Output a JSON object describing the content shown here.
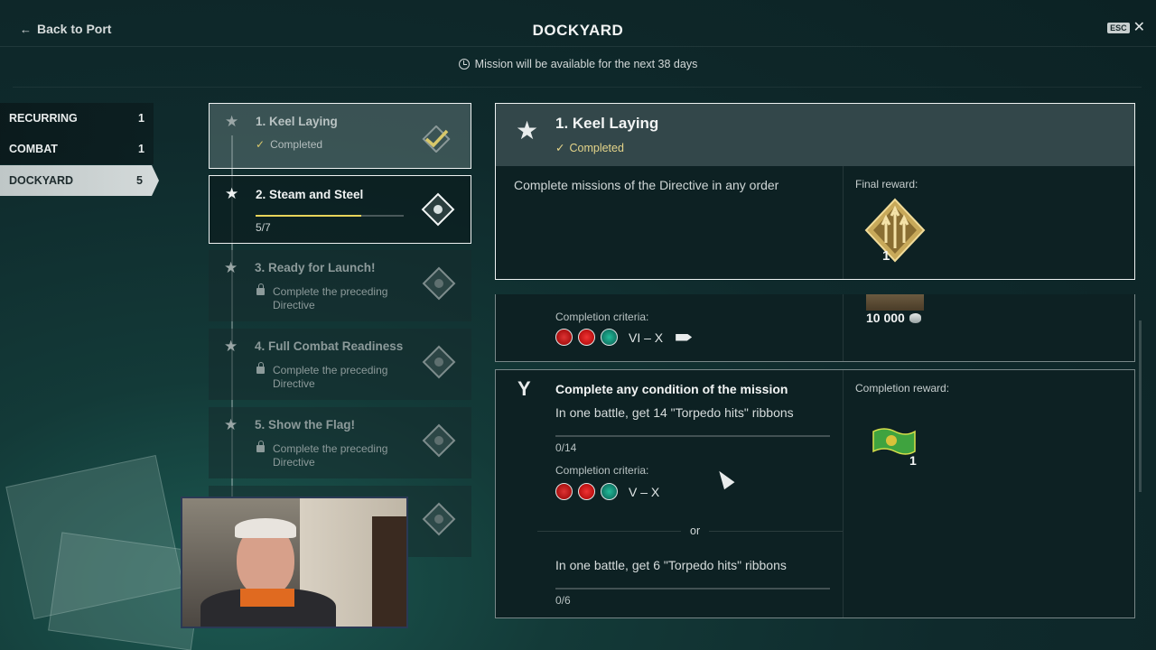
{
  "header": {
    "back_label": "Back to Port",
    "title": "DOCKYARD",
    "esc_label": "ESC",
    "availability": "Mission will be available for the next 38 days"
  },
  "categories": [
    {
      "label": "RECURRING",
      "count": "1"
    },
    {
      "label": "COMBAT",
      "count": "1"
    },
    {
      "label": "DOCKYARD",
      "count": "5"
    }
  ],
  "missions": [
    {
      "name": "1. Keel Laying",
      "status": "Completed"
    },
    {
      "name": "2. Steam and Steel",
      "progress_text": "5/7",
      "progress_fraction": 0.714
    },
    {
      "name": "3. Ready for Launch!",
      "locked_text": "Complete the preceding Directive"
    },
    {
      "name": "4. Full Combat Readiness",
      "locked_text": "Complete the preceding Directive"
    },
    {
      "name": "5. Show the Flag!",
      "locked_text": "Complete the preceding Directive"
    }
  ],
  "detail": {
    "name": "1. Keel Laying",
    "status": "Completed",
    "description": "Complete missions of the Directive in any order",
    "final_reward_label": "Final reward:",
    "final_reward_count": "1"
  },
  "criteria_panel": {
    "label": "Completion criteria:",
    "tiers": "VI – X",
    "reward_amount": "10 000"
  },
  "conditions_panel": {
    "title": "Complete any condition of the mission",
    "condition1": "In one battle, get 14 \"Torpedo hits\" ribbons",
    "condition1_progress": "0/14",
    "criteria_label": "Completion criteria:",
    "tiers": "V – X",
    "or_label": "or",
    "condition2": "In one battle, get 6 \"Torpedo hits\" ribbons",
    "condition2_progress": "0/6",
    "reward_label": "Completion reward:",
    "reward_count": "1"
  },
  "colors": {
    "accent_yellow": "#e9d45a",
    "completed_text": "#e5d58a",
    "background": "#0f2a2c"
  }
}
